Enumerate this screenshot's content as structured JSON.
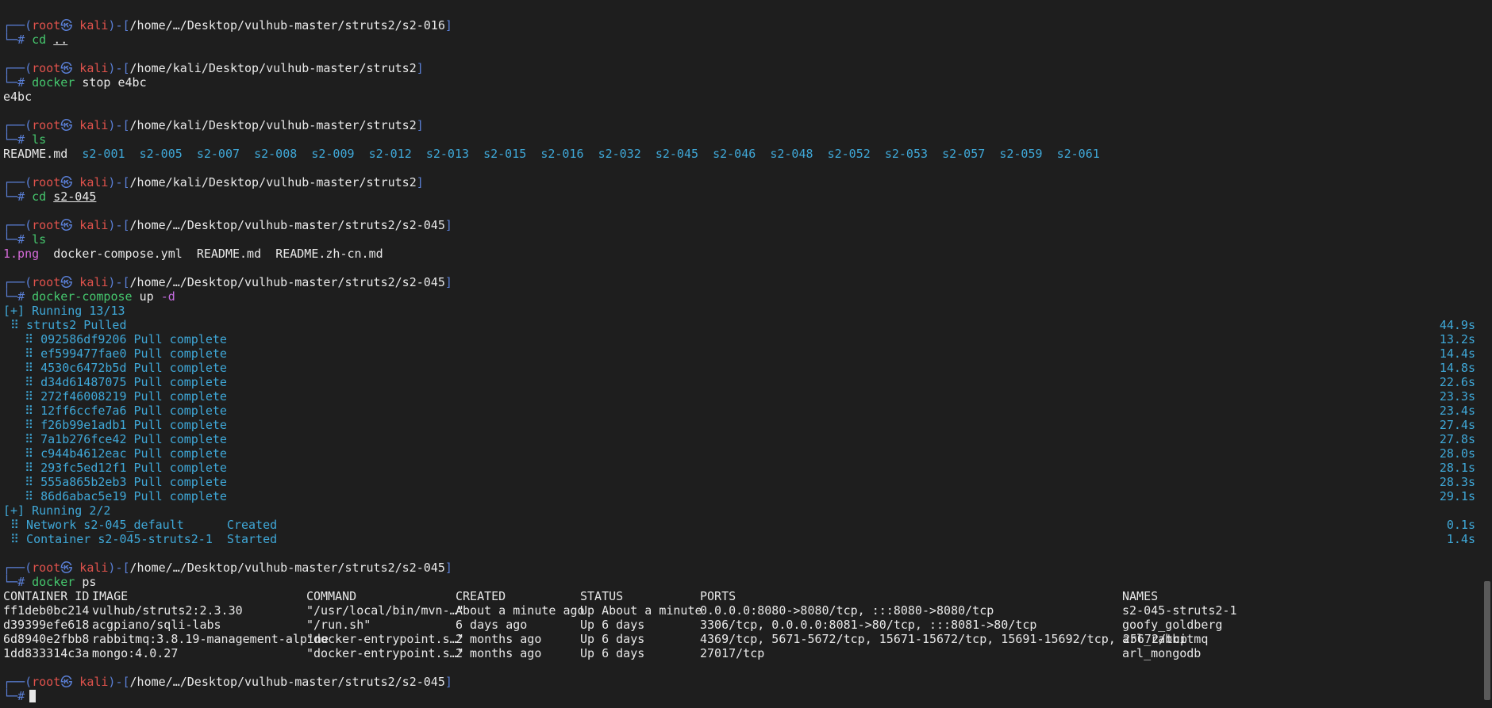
{
  "prompt": {
    "corner_top": "┌──",
    "corner_bottom": "└─",
    "user": "root",
    "skull": "㉿",
    "host": "kali",
    "symbol": "#"
  },
  "blocks": [
    {
      "path": "/home/…/Desktop/vulhub-master/struts2/s2-016",
      "cmd": "cd",
      "args": [
        {
          "text": "..",
          "underline": true
        }
      ],
      "output": []
    },
    {
      "path": "/home/kali/Desktop/vulhub-master/struts2",
      "cmd": "docker",
      "args": [
        {
          "text": "stop e4bc"
        }
      ],
      "output": [
        "e4bc"
      ]
    },
    {
      "path": "/home/kali/Desktop/vulhub-master/struts2",
      "cmd": "ls",
      "args": [],
      "output": []
    },
    {
      "path": "/home/kali/Desktop/vulhub-master/struts2",
      "cmd": "cd",
      "args": [
        {
          "text": "s2-045",
          "underline": true
        }
      ],
      "output": []
    },
    {
      "path": "/home/…/Desktop/vulhub-master/struts2/s2-045",
      "cmd": "ls",
      "args": [],
      "output": []
    },
    {
      "path": "/home/…/Desktop/vulhub-master/struts2/s2-045",
      "cmd": "docker-compose",
      "args": [
        {
          "text": "up"
        }
      ],
      "flag": "-d",
      "output": []
    },
    {
      "path": "/home/…/Desktop/vulhub-master/struts2/s2-045",
      "cmd": "docker",
      "args": [
        {
          "text": "ps"
        }
      ],
      "output": []
    },
    {
      "path": "/home/…/Desktop/vulhub-master/struts2/s2-045",
      "cmd": "",
      "args": [],
      "output": []
    }
  ],
  "ls_struts2": {
    "file": "README.md",
    "dirs": [
      "s2-001",
      "s2-005",
      "s2-007",
      "s2-008",
      "s2-009",
      "s2-012",
      "s2-013",
      "s2-015",
      "s2-016",
      "s2-032",
      "s2-045",
      "s2-046",
      "s2-048",
      "s2-052",
      "s2-053",
      "s2-057",
      "s2-059",
      "s2-061"
    ]
  },
  "ls_s2045": {
    "image": "1.png",
    "files": [
      "docker-compose.yml",
      "README.md",
      "README.zh-cn.md"
    ]
  },
  "compose": {
    "running1": "[+] Running 13/13",
    "pulled": " ⠿ struts2 Pulled",
    "pulled_time": "44.9s",
    "layers": [
      {
        "text": "   ⠿ 092586df9206 Pull complete",
        "time": "13.2s"
      },
      {
        "text": "   ⠿ ef599477fae0 Pull complete",
        "time": "14.4s"
      },
      {
        "text": "   ⠿ 4530c6472b5d Pull complete",
        "time": "14.8s"
      },
      {
        "text": "   ⠿ d34d61487075 Pull complete",
        "time": "22.6s"
      },
      {
        "text": "   ⠿ 272f46008219 Pull complete",
        "time": "23.3s"
      },
      {
        "text": "   ⠿ 12ff6ccfe7a6 Pull complete",
        "time": "23.4s"
      },
      {
        "text": "   ⠿ f26b99e1adb1 Pull complete",
        "time": "27.4s"
      },
      {
        "text": "   ⠿ 7a1b276fce42 Pull complete",
        "time": "27.8s"
      },
      {
        "text": "   ⠿ c944b4612eac Pull complete",
        "time": "28.0s"
      },
      {
        "text": "   ⠿ 293fc5ed12f1 Pull complete",
        "time": "28.1s"
      },
      {
        "text": "   ⠿ 555a865b2eb3 Pull complete",
        "time": "28.3s"
      },
      {
        "text": "   ⠿ 86d6abac5e19 Pull complete",
        "time": "29.1s"
      }
    ],
    "running2": "[+] Running 2/2",
    "network": " ⠿ Network s2-045_default      Created",
    "network_time": "0.1s",
    "container": " ⠿ Container s2-045-struts2-1  Started",
    "container_time": "1.4s"
  },
  "docker_ps": {
    "headers": [
      "CONTAINER ID",
      "IMAGE",
      "COMMAND",
      "CREATED",
      "STATUS",
      "PORTS",
      "NAMES"
    ],
    "rows": [
      [
        "ff1deb0bc214",
        "vulhub/struts2:2.3.30",
        "\"/usr/local/bin/mvn-…\"",
        "About a minute ago",
        "Up About a minute",
        "0.0.0.0:8080->8080/tcp, :::8080->8080/tcp",
        "s2-045-struts2-1"
      ],
      [
        "d39399efe618",
        "acgpiano/sqli-labs",
        "\"/run.sh\"",
        "6 days ago",
        "Up 6 days",
        "3306/tcp, 0.0.0.0:8081->80/tcp, :::8081->80/tcp",
        "goofy_goldberg"
      ],
      [
        "6d8940e2fbb8",
        "rabbitmq:3.8.19-management-alpine",
        "\"docker-entrypoint.s…\"",
        "2 months ago",
        "Up 6 days",
        "4369/tcp, 5671-5672/tcp, 15671-15672/tcp, 15691-15692/tcp, 25672/tcp",
        "arl_rabbitmq"
      ],
      [
        "1dd833314c3a",
        "mongo:4.0.27",
        "\"docker-entrypoint.s…\"",
        "2 months ago",
        "Up 6 days",
        "27017/tcp",
        "arl_mongodb"
      ]
    ]
  }
}
